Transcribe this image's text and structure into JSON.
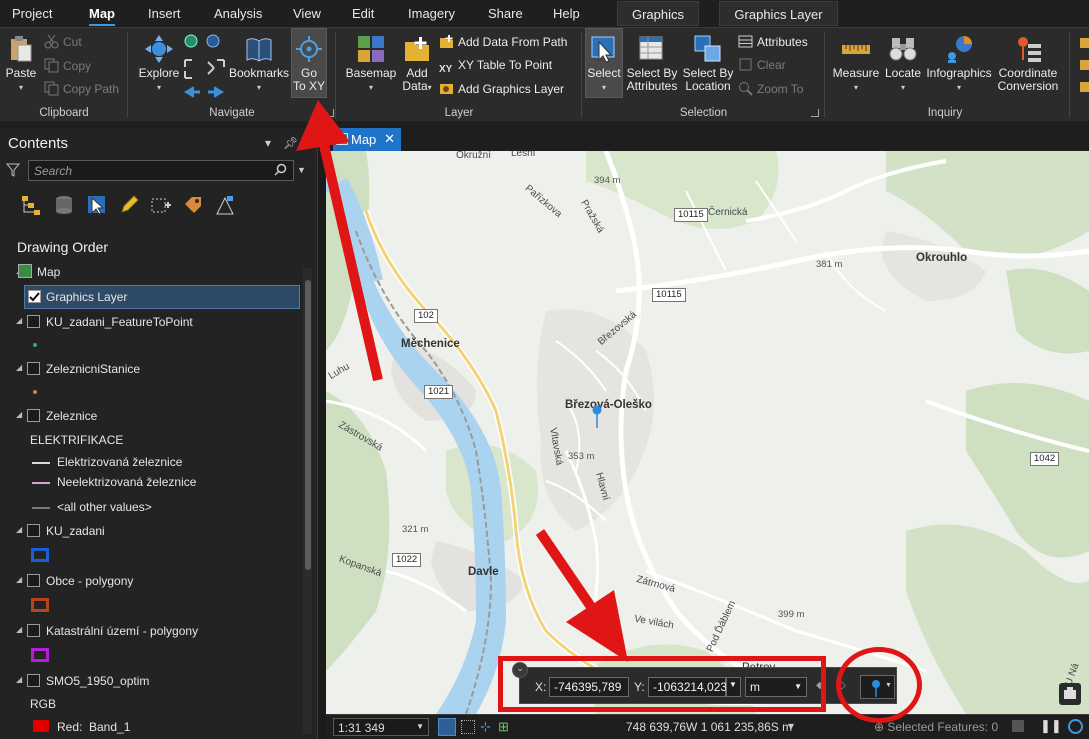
{
  "menu": {
    "tabs": [
      "Project",
      "Map",
      "Insert",
      "Analysis",
      "View",
      "Edit",
      "Imagery",
      "Share",
      "Help"
    ],
    "active_tab": "Map",
    "context_tabs": [
      "Graphics",
      "Graphics Layer"
    ]
  },
  "ribbon": {
    "clipboard": {
      "paste": "Paste",
      "cut": "Cut",
      "copy": "Copy",
      "copy_path": "Copy Path",
      "label": "Clipboard"
    },
    "navigate": {
      "explore": "Explore",
      "bookmarks": "Bookmarks",
      "go_to_xy_line1": "Go",
      "go_to_xy_line2": "To XY",
      "label": "Navigate"
    },
    "layer": {
      "basemap": "Basemap",
      "add_data_line1": "Add",
      "add_data_line2": "Data",
      "add_data_from_path": "Add Data From Path",
      "xy_table_to_point": "XY Table To Point",
      "add_graphics_layer": "Add Graphics Layer",
      "label": "Layer"
    },
    "selection": {
      "select": "Select",
      "select_by_attr_line1": "Select By",
      "select_by_attr_line2": "Attributes",
      "select_by_loc_line1": "Select By",
      "select_by_loc_line2": "Location",
      "attributes": "Attributes",
      "clear": "Clear",
      "zoom_to": "Zoom To",
      "label": "Selection"
    },
    "inquiry": {
      "measure": "Measure",
      "locate": "Locate",
      "infographics": "Infographics",
      "coord_conv_line1": "Coordinate",
      "coord_conv_line2": "Conversion",
      "label": "Inquiry"
    }
  },
  "contents": {
    "title": "Contents",
    "search_placeholder": "Search",
    "drawing_order": "Drawing Order",
    "map_node": "Map",
    "layers": [
      {
        "name": "Graphics Layer",
        "checked": true
      },
      {
        "name": "KU_zadani_FeatureToPoint",
        "checked": false
      },
      {
        "name": "ZeleznicniStanice",
        "checked": false
      },
      {
        "name": "Zeleznice",
        "checked": false
      },
      {
        "name": "KU_zadani",
        "checked": false
      },
      {
        "name": "Obce - polygony",
        "checked": false
      },
      {
        "name": "Katastrální území - polygony",
        "checked": false
      },
      {
        "name": "SMO5_1950_optim",
        "checked": false
      }
    ],
    "zeleznice_field": "ELEKTRIFIKACE",
    "zeleznice_classes": [
      "Elektrizovaná železnice",
      "Neelektrizovaná železnice",
      "<all other values>"
    ],
    "rgb_label": "RGB",
    "rgb_red": "Red:",
    "rgb_band": "Band_1",
    "colors": {
      "ku_zadani": "#1a5fd6",
      "obce": "#b5461c",
      "katastralni": "#b21fd6",
      "red_band": "#e00000",
      "elektrizovana": "#d8d8d8",
      "neelektrizovana": "#d9a0d9",
      "other": "#7a7a7a"
    }
  },
  "map": {
    "tab_label": "Map",
    "towns": [
      "Měchenice",
      "Březová-Oleško",
      "Okrouhlo",
      "Davle",
      "Petrov"
    ],
    "streets": [
      "Okružní",
      "Lesní",
      "Pařízkova",
      "Pražská",
      "Černická",
      "Březovská",
      "Vltavská",
      "Hlavní",
      "Zátrnová",
      "Ve vilách",
      "Pod Ďáblem",
      "Zástrovská",
      "Kopanská",
      "Luhu",
      "U Ná"
    ],
    "road_numbers": [
      "10115",
      "10115",
      "102",
      "1021",
      "1022",
      "1042"
    ],
    "elevations": [
      "394 m",
      "381 m",
      "353 m",
      "321 m",
      "399 m"
    ],
    "coord_x_label": "X:",
    "coord_x": "-746395,789",
    "coord_y_label": "Y:",
    "coord_y": "-1063214,023",
    "units": "m"
  },
  "status": {
    "scale": "1:31 349",
    "coords": "748 639,76W 1 061 235,86S m",
    "units_caret": "▾",
    "selected": "Selected Features: 0"
  }
}
